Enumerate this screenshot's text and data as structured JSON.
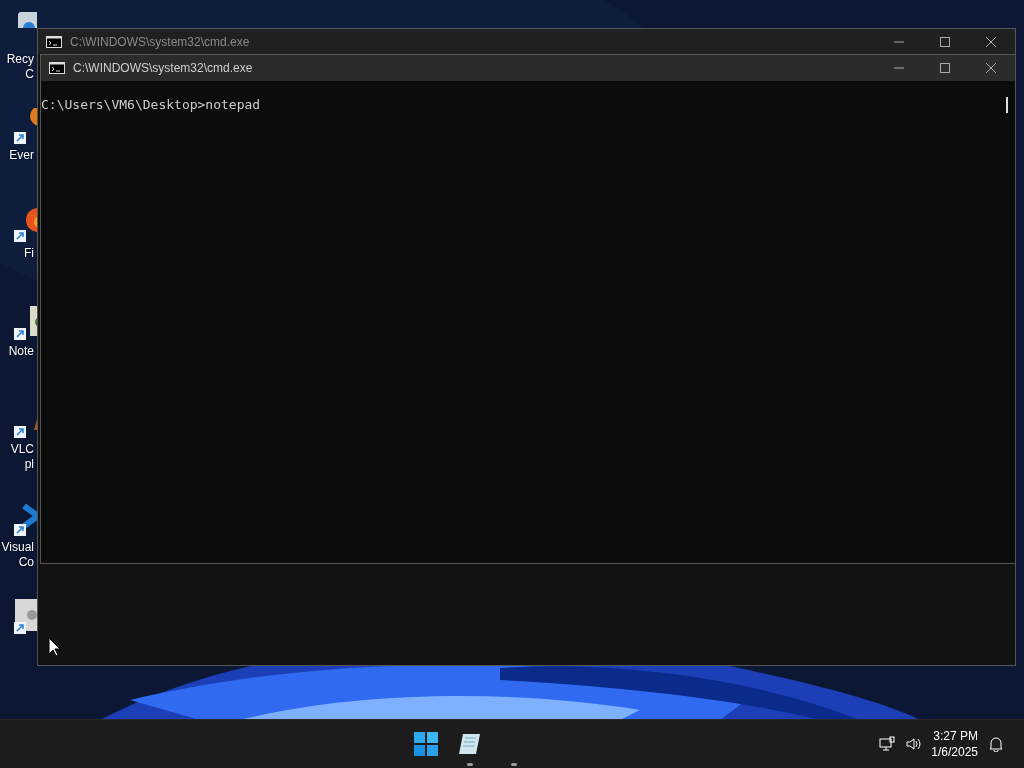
{
  "desktop_icons": [
    {
      "label": "Recy\nC",
      "kind": "bin"
    },
    {
      "label": "Ever",
      "kind": "orange"
    },
    {
      "label": "Fi",
      "kind": "fox"
    },
    {
      "label": "Note",
      "kind": "note"
    },
    {
      "label": "VLC\npl",
      "kind": "cone"
    },
    {
      "label": "Visual\nCo",
      "kind": "code"
    },
    {
      "kind": "gear"
    }
  ],
  "windows": [
    {
      "title": "C:\\WINDOWS\\system32\\cmd.exe",
      "focused": false
    },
    {
      "title": "C:\\WINDOWS\\system32\\cmd.exe",
      "focused": true,
      "lines": [
        "C:\\Users\\VM6\\Desktop>notepad"
      ]
    }
  ],
  "taskbar": {
    "time": "3:27 PM",
    "date": "1/6/2025"
  }
}
